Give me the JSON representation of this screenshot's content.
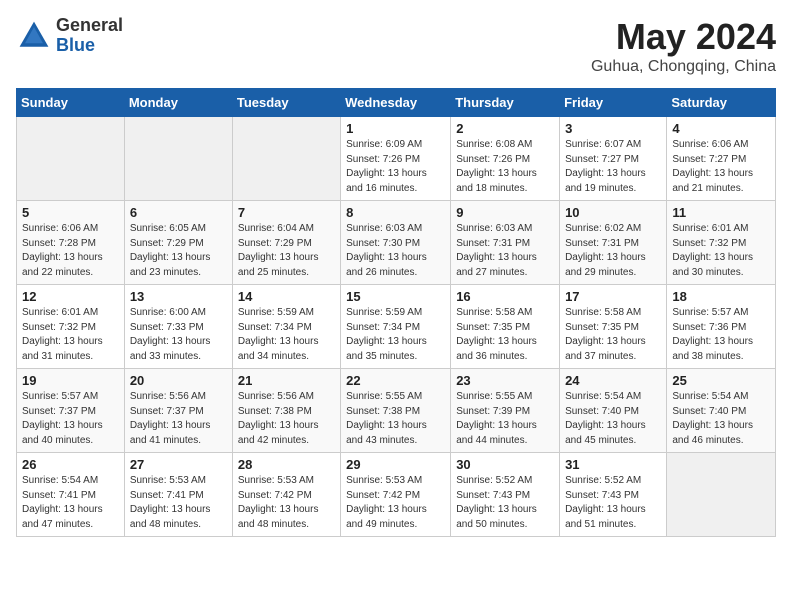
{
  "logo": {
    "general": "General",
    "blue": "Blue"
  },
  "title": "May 2024",
  "subtitle": "Guhua, Chongqing, China",
  "days_of_week": [
    "Sunday",
    "Monday",
    "Tuesday",
    "Wednesday",
    "Thursday",
    "Friday",
    "Saturday"
  ],
  "weeks": [
    [
      {
        "day": "",
        "empty": true
      },
      {
        "day": "",
        "empty": true
      },
      {
        "day": "",
        "empty": true
      },
      {
        "day": "1",
        "sunrise": "Sunrise: 6:09 AM",
        "sunset": "Sunset: 7:26 PM",
        "daylight": "Daylight: 13 hours and 16 minutes."
      },
      {
        "day": "2",
        "sunrise": "Sunrise: 6:08 AM",
        "sunset": "Sunset: 7:26 PM",
        "daylight": "Daylight: 13 hours and 18 minutes."
      },
      {
        "day": "3",
        "sunrise": "Sunrise: 6:07 AM",
        "sunset": "Sunset: 7:27 PM",
        "daylight": "Daylight: 13 hours and 19 minutes."
      },
      {
        "day": "4",
        "sunrise": "Sunrise: 6:06 AM",
        "sunset": "Sunset: 7:27 PM",
        "daylight": "Daylight: 13 hours and 21 minutes."
      }
    ],
    [
      {
        "day": "5",
        "sunrise": "Sunrise: 6:06 AM",
        "sunset": "Sunset: 7:28 PM",
        "daylight": "Daylight: 13 hours and 22 minutes."
      },
      {
        "day": "6",
        "sunrise": "Sunrise: 6:05 AM",
        "sunset": "Sunset: 7:29 PM",
        "daylight": "Daylight: 13 hours and 23 minutes."
      },
      {
        "day": "7",
        "sunrise": "Sunrise: 6:04 AM",
        "sunset": "Sunset: 7:29 PM",
        "daylight": "Daylight: 13 hours and 25 minutes."
      },
      {
        "day": "8",
        "sunrise": "Sunrise: 6:03 AM",
        "sunset": "Sunset: 7:30 PM",
        "daylight": "Daylight: 13 hours and 26 minutes."
      },
      {
        "day": "9",
        "sunrise": "Sunrise: 6:03 AM",
        "sunset": "Sunset: 7:31 PM",
        "daylight": "Daylight: 13 hours and 27 minutes."
      },
      {
        "day": "10",
        "sunrise": "Sunrise: 6:02 AM",
        "sunset": "Sunset: 7:31 PM",
        "daylight": "Daylight: 13 hours and 29 minutes."
      },
      {
        "day": "11",
        "sunrise": "Sunrise: 6:01 AM",
        "sunset": "Sunset: 7:32 PM",
        "daylight": "Daylight: 13 hours and 30 minutes."
      }
    ],
    [
      {
        "day": "12",
        "sunrise": "Sunrise: 6:01 AM",
        "sunset": "Sunset: 7:32 PM",
        "daylight": "Daylight: 13 hours and 31 minutes."
      },
      {
        "day": "13",
        "sunrise": "Sunrise: 6:00 AM",
        "sunset": "Sunset: 7:33 PM",
        "daylight": "Daylight: 13 hours and 33 minutes."
      },
      {
        "day": "14",
        "sunrise": "Sunrise: 5:59 AM",
        "sunset": "Sunset: 7:34 PM",
        "daylight": "Daylight: 13 hours and 34 minutes."
      },
      {
        "day": "15",
        "sunrise": "Sunrise: 5:59 AM",
        "sunset": "Sunset: 7:34 PM",
        "daylight": "Daylight: 13 hours and 35 minutes."
      },
      {
        "day": "16",
        "sunrise": "Sunrise: 5:58 AM",
        "sunset": "Sunset: 7:35 PM",
        "daylight": "Daylight: 13 hours and 36 minutes."
      },
      {
        "day": "17",
        "sunrise": "Sunrise: 5:58 AM",
        "sunset": "Sunset: 7:35 PM",
        "daylight": "Daylight: 13 hours and 37 minutes."
      },
      {
        "day": "18",
        "sunrise": "Sunrise: 5:57 AM",
        "sunset": "Sunset: 7:36 PM",
        "daylight": "Daylight: 13 hours and 38 minutes."
      }
    ],
    [
      {
        "day": "19",
        "sunrise": "Sunrise: 5:57 AM",
        "sunset": "Sunset: 7:37 PM",
        "daylight": "Daylight: 13 hours and 40 minutes."
      },
      {
        "day": "20",
        "sunrise": "Sunrise: 5:56 AM",
        "sunset": "Sunset: 7:37 PM",
        "daylight": "Daylight: 13 hours and 41 minutes."
      },
      {
        "day": "21",
        "sunrise": "Sunrise: 5:56 AM",
        "sunset": "Sunset: 7:38 PM",
        "daylight": "Daylight: 13 hours and 42 minutes."
      },
      {
        "day": "22",
        "sunrise": "Sunrise: 5:55 AM",
        "sunset": "Sunset: 7:38 PM",
        "daylight": "Daylight: 13 hours and 43 minutes."
      },
      {
        "day": "23",
        "sunrise": "Sunrise: 5:55 AM",
        "sunset": "Sunset: 7:39 PM",
        "daylight": "Daylight: 13 hours and 44 minutes."
      },
      {
        "day": "24",
        "sunrise": "Sunrise: 5:54 AM",
        "sunset": "Sunset: 7:40 PM",
        "daylight": "Daylight: 13 hours and 45 minutes."
      },
      {
        "day": "25",
        "sunrise": "Sunrise: 5:54 AM",
        "sunset": "Sunset: 7:40 PM",
        "daylight": "Daylight: 13 hours and 46 minutes."
      }
    ],
    [
      {
        "day": "26",
        "sunrise": "Sunrise: 5:54 AM",
        "sunset": "Sunset: 7:41 PM",
        "daylight": "Daylight: 13 hours and 47 minutes."
      },
      {
        "day": "27",
        "sunrise": "Sunrise: 5:53 AM",
        "sunset": "Sunset: 7:41 PM",
        "daylight": "Daylight: 13 hours and 48 minutes."
      },
      {
        "day": "28",
        "sunrise": "Sunrise: 5:53 AM",
        "sunset": "Sunset: 7:42 PM",
        "daylight": "Daylight: 13 hours and 48 minutes."
      },
      {
        "day": "29",
        "sunrise": "Sunrise: 5:53 AM",
        "sunset": "Sunset: 7:42 PM",
        "daylight": "Daylight: 13 hours and 49 minutes."
      },
      {
        "day": "30",
        "sunrise": "Sunrise: 5:52 AM",
        "sunset": "Sunset: 7:43 PM",
        "daylight": "Daylight: 13 hours and 50 minutes."
      },
      {
        "day": "31",
        "sunrise": "Sunrise: 5:52 AM",
        "sunset": "Sunset: 7:43 PM",
        "daylight": "Daylight: 13 hours and 51 minutes."
      },
      {
        "day": "",
        "empty": true
      }
    ]
  ]
}
